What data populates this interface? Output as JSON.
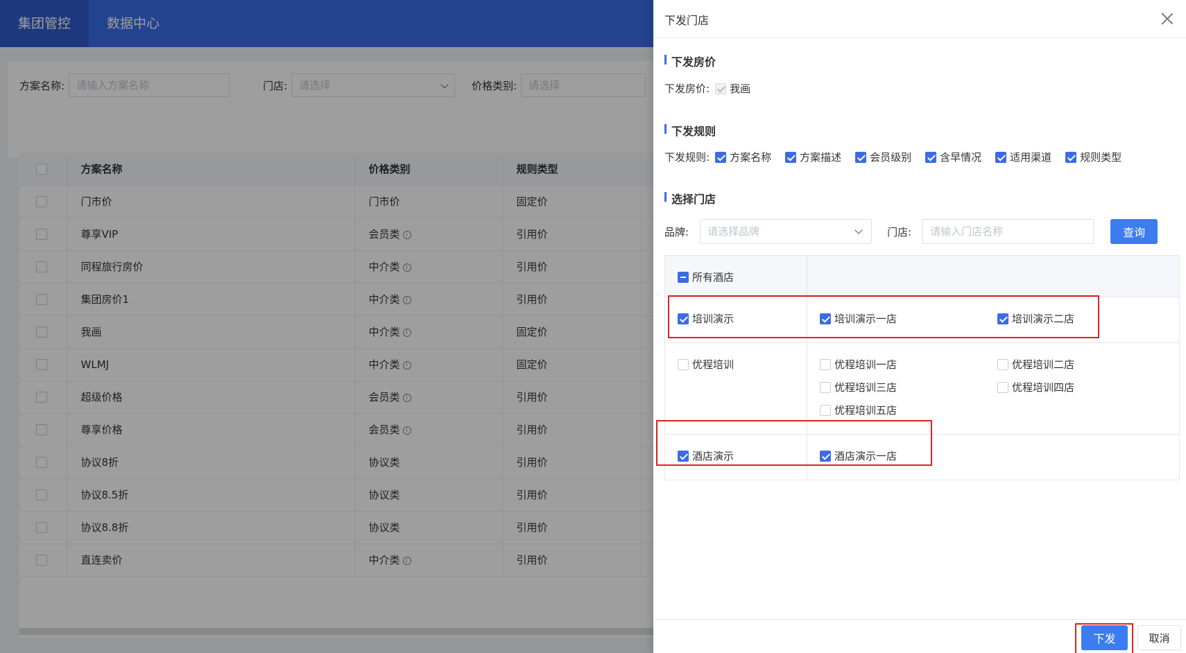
{
  "topnav": {
    "items": [
      {
        "label": "集团管控",
        "active": true
      },
      {
        "label": "数据中心",
        "active": false
      }
    ]
  },
  "filters": {
    "plan_name_label": "方案名称:",
    "plan_name_placeholder": "请输入方案名称",
    "store_label": "门店:",
    "store_placeholder": "请选择",
    "price_type_label": "价格类别:",
    "price_type_placeholder": "请选择"
  },
  "plan_table": {
    "columns": [
      "方案名称",
      "价格类别",
      "规则类型"
    ],
    "rows": [
      {
        "name": "门市价",
        "price_type": "门市价",
        "info": false,
        "rule_type": "固定价"
      },
      {
        "name": "尊享VIP",
        "price_type": "会员类",
        "info": true,
        "rule_type": "引用价"
      },
      {
        "name": "同程旅行房价",
        "price_type": "中介类",
        "info": true,
        "rule_type": "引用价"
      },
      {
        "name": "集团房价1",
        "price_type": "中介类",
        "info": true,
        "rule_type": "引用价"
      },
      {
        "name": "我画",
        "price_type": "中介类",
        "info": true,
        "rule_type": "固定价"
      },
      {
        "name": "WLMJ",
        "price_type": "中介类",
        "info": true,
        "rule_type": "固定价"
      },
      {
        "name": "超级价格",
        "price_type": "会员类",
        "info": true,
        "rule_type": "引用价"
      },
      {
        "name": "尊享价格",
        "price_type": "会员类",
        "info": true,
        "rule_type": "引用价"
      },
      {
        "name": "协议8折",
        "price_type": "协议类",
        "info": false,
        "rule_type": "引用价"
      },
      {
        "name": "协议8.5折",
        "price_type": "协议类",
        "info": false,
        "rule_type": "引用价"
      },
      {
        "name": "协议8.8折",
        "price_type": "协议类",
        "info": false,
        "rule_type": "引用价"
      },
      {
        "name": "直连卖价",
        "price_type": "中介类",
        "info": true,
        "rule_type": "引用价"
      }
    ]
  },
  "drawer": {
    "title": "下发门店",
    "price_section": {
      "title": "下发房价",
      "label": "下发房价:",
      "option": "我画"
    },
    "rule_section": {
      "title": "下发规则",
      "label": "下发规则:",
      "options": [
        "方案名称",
        "方案描述",
        "会员级别",
        "含早情况",
        "适用渠道",
        "规则类型"
      ]
    },
    "store_section": {
      "title": "选择门店",
      "brand_label": "品牌:",
      "brand_placeholder": "请选择品牌",
      "store_label": "门店:",
      "store_placeholder": "请输入门店名称",
      "query_button": "查询",
      "all_hotels": "所有酒店",
      "groups": [
        {
          "brand": "培训演示",
          "checked": true,
          "stores": [
            {
              "name": "培训演示一店",
              "checked": true
            },
            {
              "name": "培训演示二店",
              "checked": true
            }
          ]
        },
        {
          "brand": "优程培训",
          "checked": false,
          "stores": [
            {
              "name": "优程培训一店",
              "checked": false
            },
            {
              "name": "优程培训二店",
              "checked": false
            },
            {
              "name": "优程培训三店",
              "checked": false
            },
            {
              "name": "优程培训四店",
              "checked": false
            },
            {
              "name": "优程培训五店",
              "checked": false
            }
          ]
        },
        {
          "brand": "酒店演示",
          "checked": true,
          "stores": [
            {
              "name": "酒店演示一店",
              "checked": true
            }
          ]
        }
      ]
    },
    "footer": {
      "submit": "下发",
      "cancel": "取消"
    }
  }
}
